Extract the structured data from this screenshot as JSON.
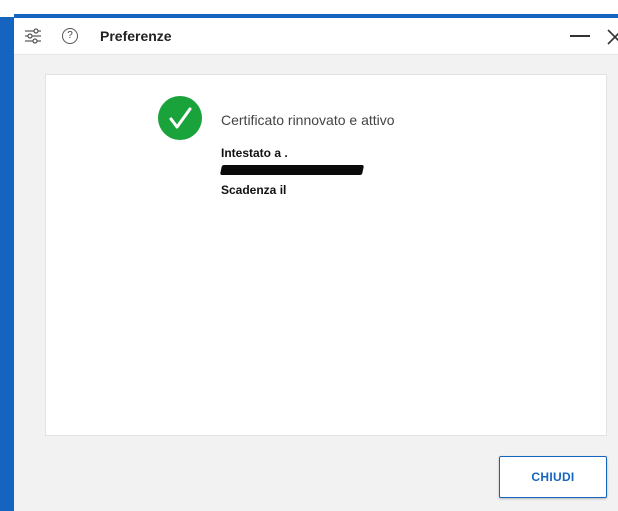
{
  "window": {
    "title": "Preferenze",
    "help_glyph": "?",
    "icons": [
      "settings-sliders-icon",
      "help-icon",
      "minimize-icon",
      "close-icon"
    ]
  },
  "panel": {
    "status_message": "Certificato rinnovato e attivo",
    "issued_to_label": "Intestato a .",
    "expiry_label": "Scadenza il",
    "status_icon": "check-circle-icon"
  },
  "footer": {
    "close_label": "CHIUDI"
  },
  "colors": {
    "accent": "#1565c0",
    "success": "#1aa33a",
    "background": "#f2f2f2"
  }
}
